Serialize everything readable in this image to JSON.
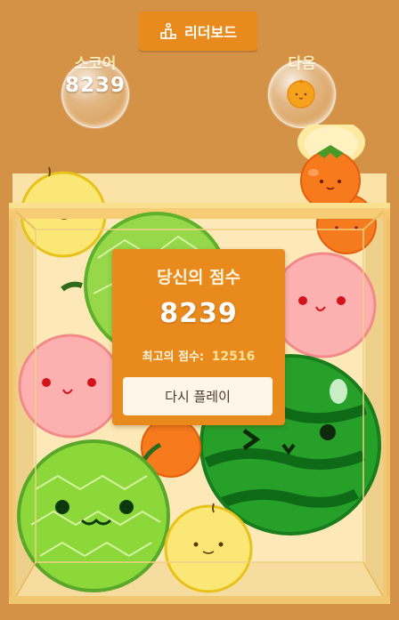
{
  "header": {
    "leaderboard_label": "리더보드",
    "leaderboard_icon": "podium-icon"
  },
  "score": {
    "label": "스코어",
    "value": "8239"
  },
  "next": {
    "label": "다음",
    "fruit": "tangerine"
  },
  "game_over": {
    "title": "당신의 점수",
    "score": "8239",
    "best_label": "최고의 점수:",
    "best_value": "12516",
    "replay_label": "다시 플레이"
  },
  "fruits_in_box": [
    "persimmon",
    "tangerine",
    "tangerine",
    "pear",
    "melon",
    "peach",
    "peach",
    "watermelon",
    "tangerine",
    "melon",
    "pear"
  ],
  "colors": {
    "background": "#d39246",
    "accent": "#e98a1c",
    "box_fill": "#fbe3a7",
    "box_rim": "#f2c66e"
  }
}
